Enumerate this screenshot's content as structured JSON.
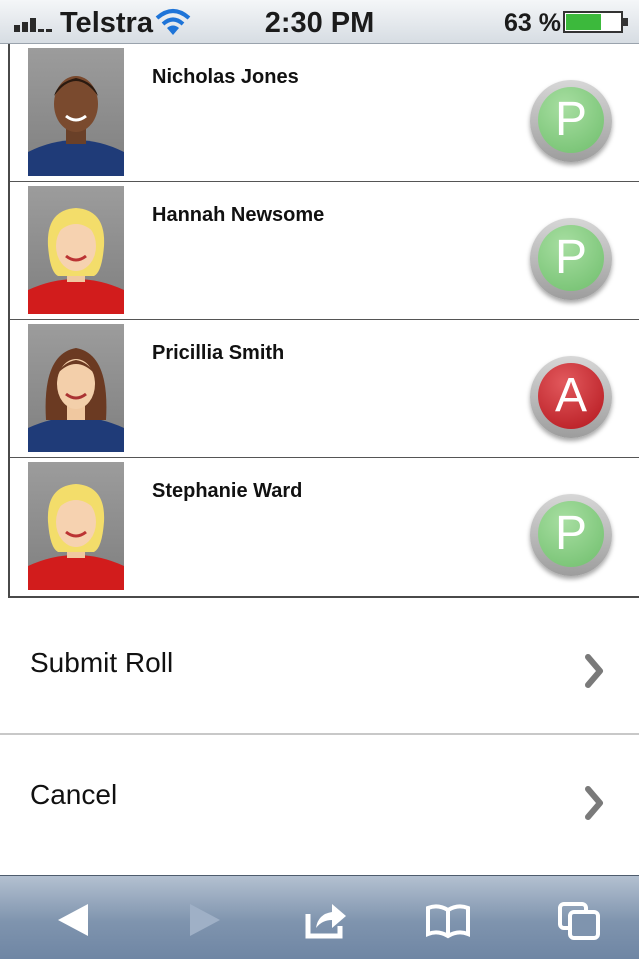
{
  "status_bar": {
    "carrier": "Telstra",
    "time": "2:30 PM",
    "battery": "63 %"
  },
  "students": [
    {
      "name": "Nicholas Jones",
      "status": "P",
      "status_color": "#6fbe6c"
    },
    {
      "name": "Hannah Newsome",
      "status": "P",
      "status_color": "#6fbe6c"
    },
    {
      "name": "Pricillia Smith",
      "status": "A",
      "status_color": "#b3151c"
    },
    {
      "name": "Stephanie Ward",
      "status": "P",
      "status_color": "#6fbe6c"
    }
  ],
  "actions": {
    "submit_label": "Submit Roll",
    "cancel_label": "Cancel"
  },
  "toolbar": {
    "icons": [
      "back-icon",
      "forward-icon",
      "share-icon",
      "bookmarks-icon",
      "tabs-icon"
    ]
  }
}
